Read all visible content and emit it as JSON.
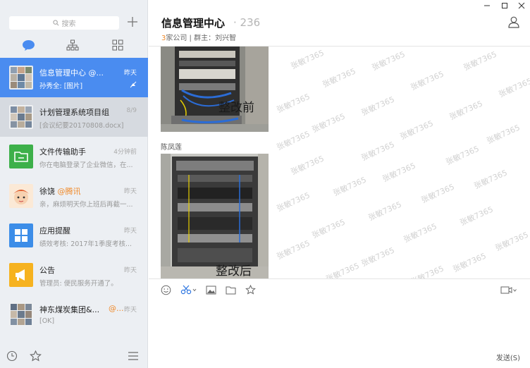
{
  "colors": {
    "accent": "#4a8cf0",
    "tag": "#f08a2a",
    "sidebar_bg": "#eceff3",
    "sidebar_selected": "#d6dae0"
  },
  "search": {
    "placeholder": "搜索"
  },
  "tabs": [
    "chat-icon",
    "org-icon",
    "apps-icon"
  ],
  "conversations": [
    {
      "title": "信息管理中心",
      "title_suffix": " @...",
      "time": "昨天",
      "preview": "孙秀全: [图片]",
      "muted": true,
      "state": "active",
      "avatar": "photo-grid"
    },
    {
      "title": "计划管理系统项目组",
      "title_suffix": "",
      "time": "8/9",
      "preview": "[会议纪要20170808.docx]",
      "muted": false,
      "state": "highlighted",
      "avatar": "photo-grid"
    },
    {
      "title": "文件传输助手",
      "title_suffix": "",
      "time": "4分钟前",
      "preview": "你在电脑登录了企业微信，在...",
      "muted": false,
      "state": "normal",
      "avatar": "folder-icon"
    },
    {
      "title": "徐饶",
      "title_tag": "@腾讯",
      "time": "昨天",
      "preview": "亲，麻烦明天你上班后再截一...",
      "muted": false,
      "state": "normal",
      "avatar": "cartoon"
    },
    {
      "title": "应用提醒",
      "title_suffix": "",
      "time": "昨天",
      "preview": "绩效考核: 2017年1季度考核...",
      "muted": false,
      "state": "normal",
      "avatar": "grid-icon"
    },
    {
      "title": "公告",
      "title_suffix": "",
      "time": "昨天",
      "preview": "管理员: 便民服务开通了。",
      "muted": false,
      "state": "normal",
      "avatar": "megaphone-icon"
    },
    {
      "title": "神东煤炭集团&...",
      "title_tag": "@...",
      "time": "昨天",
      "preview": "[OK]",
      "muted": false,
      "state": "normal",
      "avatar": "photo-grid"
    }
  ],
  "chat": {
    "title": "信息管理中心",
    "count": "· 236",
    "company_count": "3",
    "company_label": "家公司 | 群主：刘兴智",
    "watermark": "张敏7365",
    "messages": [
      {
        "type": "image",
        "caption": "整改前"
      },
      {
        "type": "sender",
        "name": "陈凤莲"
      },
      {
        "type": "image",
        "caption": "整改后"
      }
    ]
  },
  "composer": {
    "send_label": "发送(S)"
  }
}
